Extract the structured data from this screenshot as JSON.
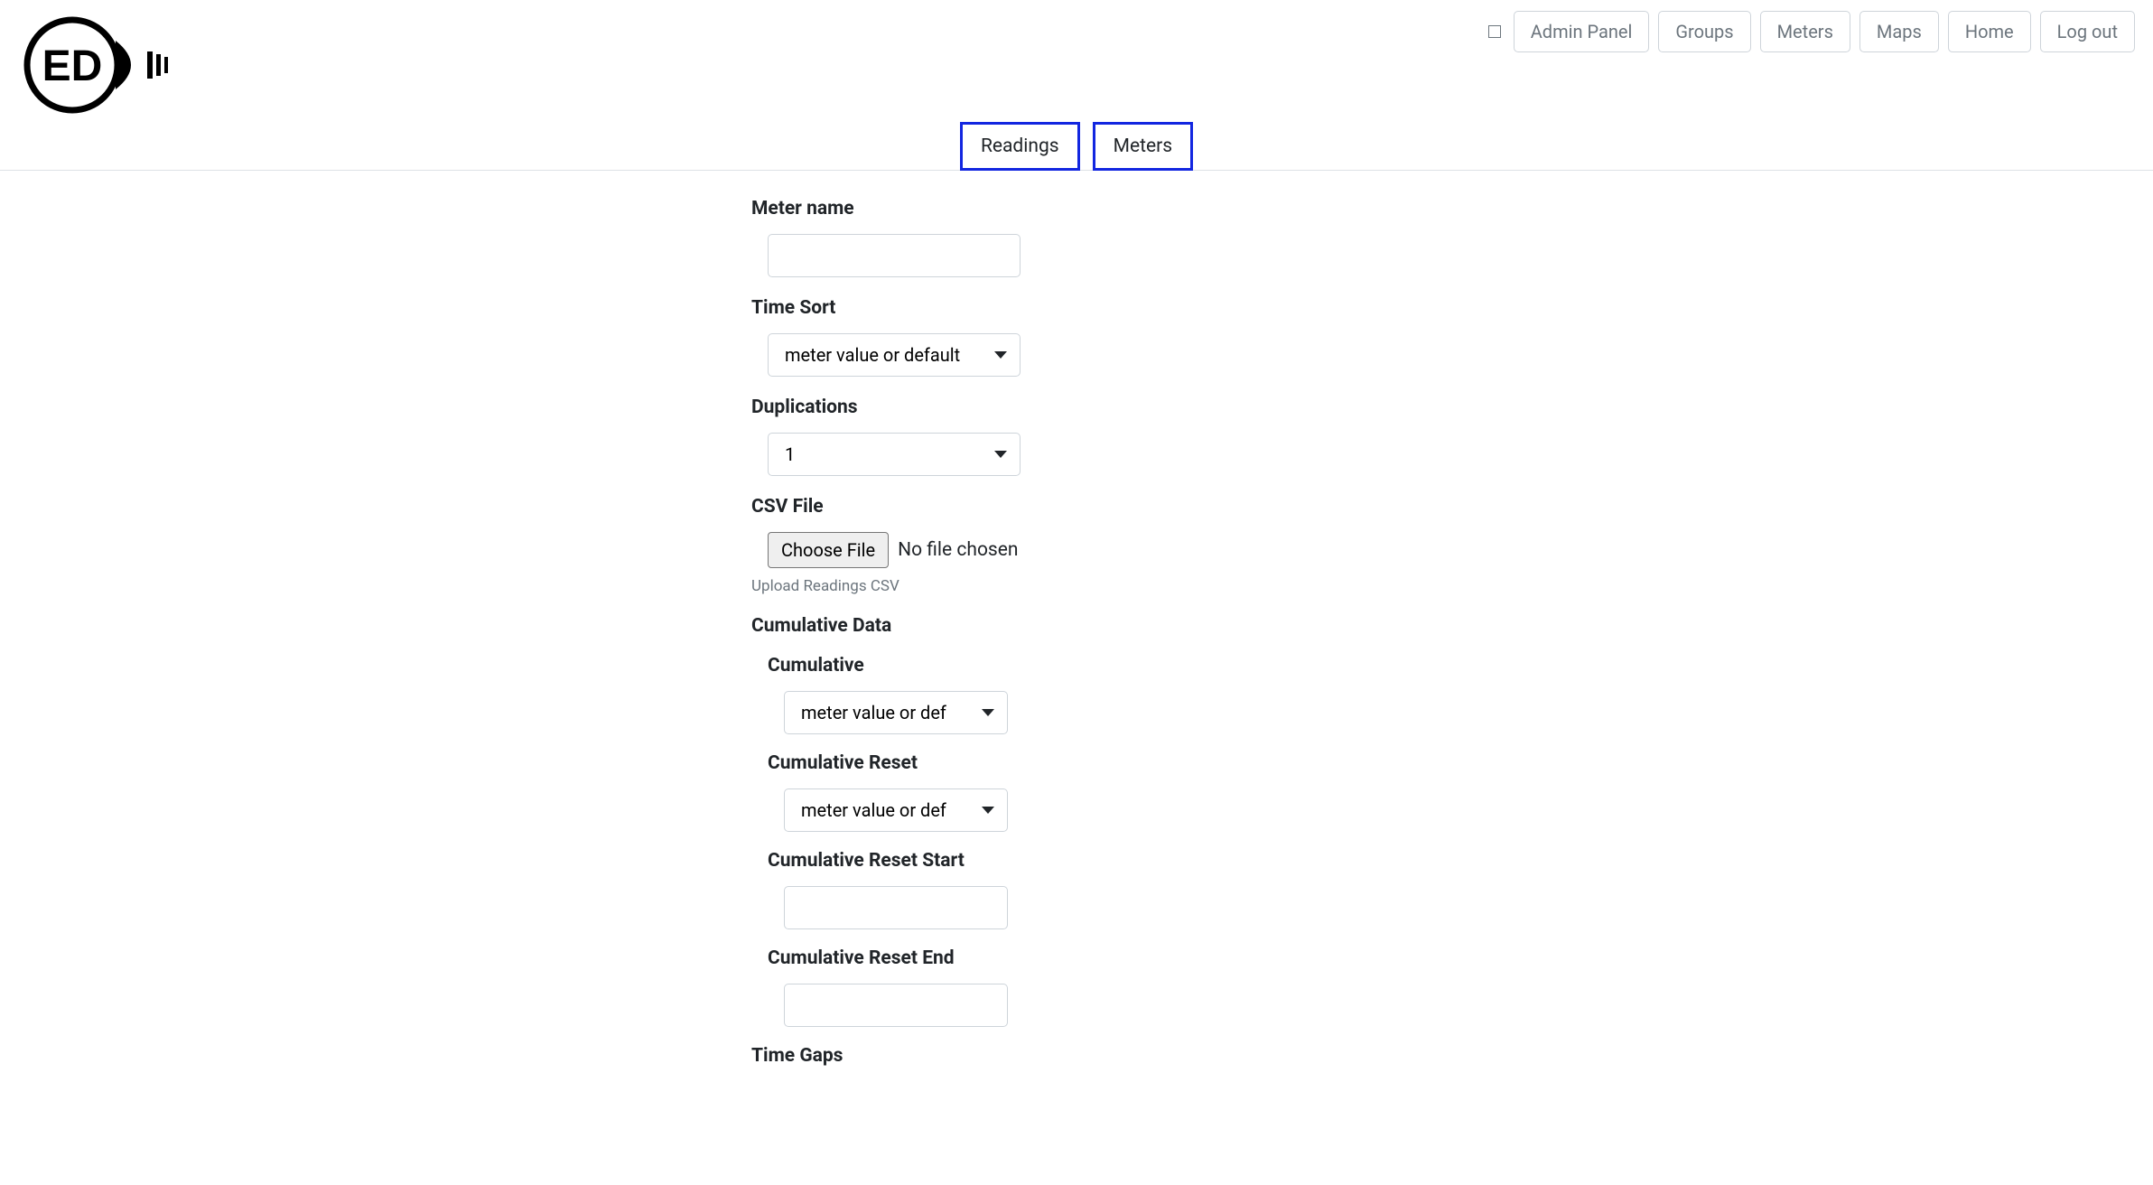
{
  "nav": {
    "admin_panel": "Admin Panel",
    "groups": "Groups",
    "meters": "Meters",
    "maps": "Maps",
    "home": "Home",
    "logout": "Log out"
  },
  "tabs": {
    "readings": "Readings",
    "meters": "Meters"
  },
  "form": {
    "meter_name_label": "Meter name",
    "meter_name_value": "",
    "time_sort_label": "Time Sort",
    "time_sort_value": "meter value or default",
    "duplications_label": "Duplications",
    "duplications_value": "1",
    "csv_file_label": "CSV File",
    "choose_file_label": "Choose File",
    "no_file_chosen": "No file chosen",
    "upload_hint": "Upload Readings CSV",
    "cumulative_data_heading": "Cumulative Data",
    "cumulative_label": "Cumulative",
    "cumulative_value": "meter value or def",
    "cumulative_reset_label": "Cumulative Reset",
    "cumulative_reset_value": "meter value or def",
    "cumulative_reset_start_label": "Cumulative Reset Start",
    "cumulative_reset_start_value": "",
    "cumulative_reset_end_label": "Cumulative Reset End",
    "cumulative_reset_end_value": "",
    "time_gaps_heading": "Time Gaps"
  }
}
